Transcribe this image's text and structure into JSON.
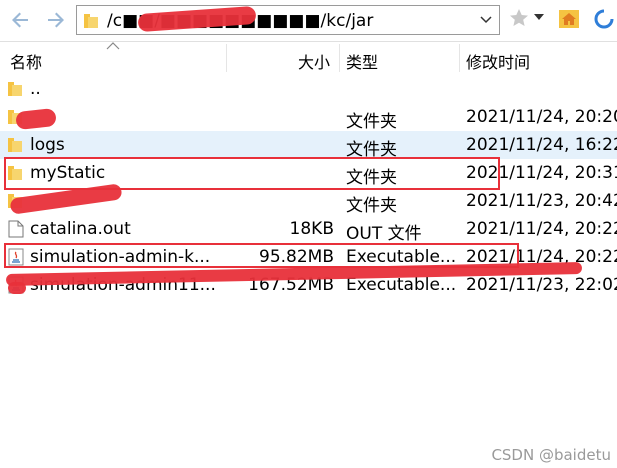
{
  "toolbar": {
    "path": "/c■■/■■■■■■■■■■/kc/jar"
  },
  "columns": {
    "name": "名称",
    "size": "大小",
    "type": "类型",
    "modified": "修改时间"
  },
  "rows": [
    {
      "name": "..",
      "size": "",
      "type": "",
      "date": "",
      "icon": "folder-icon"
    },
    {
      "name": "",
      "size": "",
      "type": "文件夹",
      "date": "2021/11/24, 20:20",
      "icon": "folder-icon"
    },
    {
      "name": "logs",
      "size": "",
      "type": "文件夹",
      "date": "2021/11/24, 16:22",
      "icon": "folder-icon"
    },
    {
      "name": "myStatic",
      "size": "",
      "type": "文件夹",
      "date": "2021/11/24, 20:31",
      "icon": "folder-icon"
    },
    {
      "name": "",
      "size": "",
      "type": "文件夹",
      "date": "2021/11/23, 20:42",
      "icon": "folder-icon"
    },
    {
      "name": "catalina.out",
      "size": "18KB",
      "type": "OUT 文件",
      "date": "2021/11/24, 20:22",
      "icon": "file-icon"
    },
    {
      "name": "simulation-admin-k...",
      "size": "95.82MB",
      "type": "Executable...",
      "date": "2021/11/24, 20:22",
      "icon": "java-icon"
    },
    {
      "name": "simulation-admin11...",
      "size": "167.52MB",
      "type": "Executable...",
      "date": "2021/11/23, 22:02",
      "icon": "java-icon"
    }
  ],
  "watermark": "CSDN @baidetu",
  "colors": {
    "annotation": "#e8303a",
    "folder": "#f5c342",
    "selected_row": "#e5f1fb"
  }
}
